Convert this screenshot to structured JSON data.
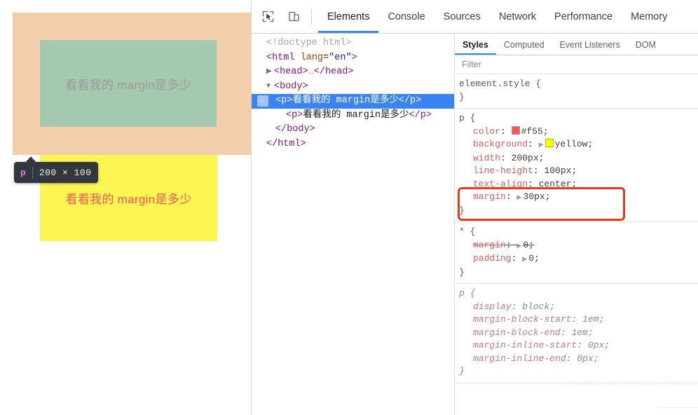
{
  "viewport": {
    "highlight_tooltip": {
      "tag": "p",
      "dimensions": "200 × 100"
    },
    "paragraph_1_text": "看看我的 margin是多少",
    "paragraph_2_text": "看看我的 margin是多少",
    "colors": {
      "margin_box": "#f3ceaa",
      "content_box": "#a5c9ae",
      "yellow_box": "#fdf552",
      "yellow_text": "#ff5555",
      "tooltip_bg": "#32373d",
      "tooltip_tag": "#e87cdc"
    }
  },
  "devtools": {
    "toolbar": {
      "inspect_icon": "inspect-element-icon",
      "device_icon": "device-toolbar-icon",
      "tabs": [
        {
          "label": "Elements",
          "active": true
        },
        {
          "label": "Console",
          "active": false
        },
        {
          "label": "Sources",
          "active": false
        },
        {
          "label": "Network",
          "active": false
        },
        {
          "label": "Performance",
          "active": false
        },
        {
          "label": "Memory",
          "active": false
        }
      ]
    },
    "dom_tree": [
      {
        "indent": 0,
        "type": "doctype",
        "text": "<!doctype html>"
      },
      {
        "indent": 0,
        "type": "open",
        "tag": "html",
        "attr": "lang",
        "value": "\"en\""
      },
      {
        "indent": 1,
        "type": "collapsed",
        "tag": "head",
        "text": "…"
      },
      {
        "indent": 1,
        "type": "expanded",
        "tag": "body"
      },
      {
        "indent": 2,
        "type": "element",
        "tag": "p",
        "text": "看看我的 margin是多少",
        "selected": true,
        "badge": "…"
      },
      {
        "indent": 2,
        "type": "element",
        "tag": "p",
        "text": "看看我的 margin是多少",
        "selected": false
      },
      {
        "indent": 1,
        "type": "close",
        "tag": "body"
      },
      {
        "indent": 0,
        "type": "close",
        "tag": "html"
      }
    ],
    "styles": {
      "tabs": [
        {
          "label": "Styles",
          "active": true
        },
        {
          "label": "Computed",
          "active": false
        },
        {
          "label": "Event Listeners",
          "active": false
        },
        {
          "label": "DOM",
          "active": false
        }
      ],
      "filter_placeholder": "Filter",
      "rules": [
        {
          "selector": "element.style {",
          "close": "}",
          "origin": "author",
          "declarations": []
        },
        {
          "selector": "p {",
          "close": "}",
          "origin": "author",
          "declarations": [
            {
              "prop": "color",
              "value": "#f55",
              "swatch": "#ff5555",
              "expandable": false
            },
            {
              "prop": "background",
              "value": "yellow",
              "swatch": "#ffff00",
              "expandable": true
            },
            {
              "prop": "width",
              "value": "200px",
              "expandable": false
            },
            {
              "prop": "line-height",
              "value": "100px",
              "expandable": false
            },
            {
              "prop": "text-align",
              "value": "center",
              "expandable": false
            },
            {
              "prop": "margin",
              "value": "30px",
              "expandable": true,
              "highlighted": true
            }
          ]
        },
        {
          "selector": "* {",
          "close": "}",
          "origin": "author",
          "declarations": [
            {
              "prop": "margin",
              "value": "0",
              "expandable": true,
              "overridden": true
            },
            {
              "prop": "padding",
              "value": "0",
              "expandable": true
            }
          ]
        },
        {
          "selector": "p {",
          "close": "}",
          "origin": "user-agent",
          "declarations": [
            {
              "prop": "display",
              "value": "block"
            },
            {
              "prop": "margin-block-start",
              "value": "1em"
            },
            {
              "prop": "margin-block-end",
              "value": "1em"
            },
            {
              "prop": "margin-inline-start",
              "value": "0px"
            },
            {
              "prop": "margin-inline-end",
              "value": "0px"
            }
          ]
        }
      ]
    },
    "annotation": {
      "color": "#e8391d",
      "targets": "margin: 30px;"
    },
    "watermark": "https://blog.csdn.net/weixin_39433006"
  }
}
